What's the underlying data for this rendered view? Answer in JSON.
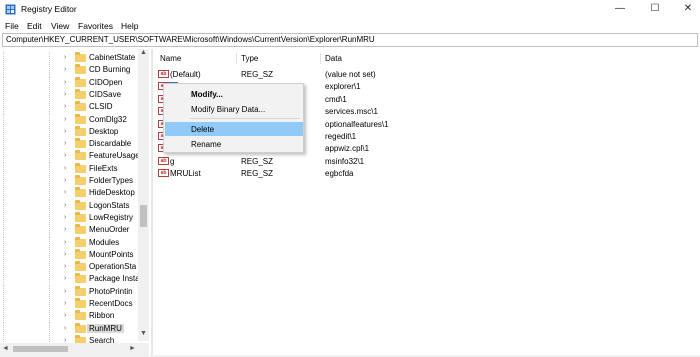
{
  "window": {
    "title": "Registry Editor",
    "minimize_glyph": "—",
    "maximize_glyph": "☐",
    "close_glyph": "✕"
  },
  "menu": {
    "file": "File",
    "edit": "Edit",
    "view": "View",
    "favorites": "Favorites",
    "help": "Help"
  },
  "address": {
    "path": "Computer\\HKEY_CURRENT_USER\\SOFTWARE\\Microsoft\\Windows\\CurrentVersion\\Explorer\\RunMRU"
  },
  "tree": {
    "items": [
      {
        "label": "CabinetState"
      },
      {
        "label": "CD Burning"
      },
      {
        "label": "CIDOpen"
      },
      {
        "label": "CIDSave"
      },
      {
        "label": "CLSID"
      },
      {
        "label": "ComDlg32"
      },
      {
        "label": "Desktop"
      },
      {
        "label": "Discardable"
      },
      {
        "label": "FeatureUsage"
      },
      {
        "label": "FileExts"
      },
      {
        "label": "FolderTypes"
      },
      {
        "label": "HideDesktop"
      },
      {
        "label": "LogonStats"
      },
      {
        "label": "LowRegistry"
      },
      {
        "label": "MenuOrder"
      },
      {
        "label": "Modules"
      },
      {
        "label": "MountPoints"
      },
      {
        "label": "OperationSta"
      },
      {
        "label": "Package Insta"
      },
      {
        "label": "PhotoPrintin"
      },
      {
        "label": "RecentDocs"
      },
      {
        "label": "Ribbon"
      },
      {
        "label": "RunMRU",
        "selected": true
      },
      {
        "label": "Search"
      }
    ],
    "chevron_glyph": "›"
  },
  "list": {
    "headers": {
      "name": "Name",
      "type": "Type",
      "data": "Data"
    },
    "icon_text": "ab",
    "rows": [
      {
        "name": "(Default)",
        "type": "REG_SZ",
        "data": "(value not set)"
      },
      {
        "name": "",
        "type": "",
        "data": "explorer\\1"
      },
      {
        "name": "",
        "type": "",
        "data": "cmd\\1"
      },
      {
        "name": "",
        "type": "",
        "data": "services.msc\\1"
      },
      {
        "name": "",
        "type": "",
        "data": "optionalfeatures\\1"
      },
      {
        "name": "",
        "type": "",
        "data": "regedit\\1"
      },
      {
        "name": "",
        "type": "REG_SZ",
        "data": "appwiz.cpl\\1"
      },
      {
        "name": "g",
        "type": "REG_SZ",
        "data": "msinfo32\\1"
      },
      {
        "name": "MRUList",
        "type": "REG_SZ",
        "data": "egbcfda"
      }
    ]
  },
  "context_menu": {
    "modify": "Modify...",
    "modify_binary": "Modify Binary Data...",
    "delete": "Delete",
    "rename": "Rename"
  },
  "scroll": {
    "up": "▲",
    "down": "▼",
    "left": "◄",
    "right": "►"
  }
}
